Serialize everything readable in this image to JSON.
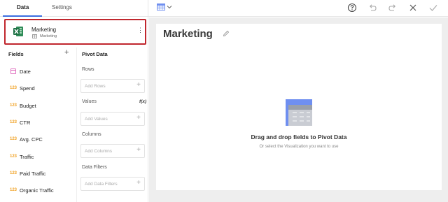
{
  "tabs": {
    "data": "Data",
    "settings": "Settings"
  },
  "datasource": {
    "name": "Marketing",
    "sub": "Marketing"
  },
  "fields": {
    "header": "Fields",
    "items": [
      {
        "label": "Date",
        "type": "date"
      },
      {
        "label": "Spend",
        "type": "123"
      },
      {
        "label": "Budget",
        "type": "123"
      },
      {
        "label": "CTR",
        "type": "123"
      },
      {
        "label": "Avg. CPC",
        "type": "123"
      },
      {
        "label": "Traffic",
        "type": "123"
      },
      {
        "label": "Paid Traffic",
        "type": "123"
      },
      {
        "label": "Organic Traffic",
        "type": "123"
      }
    ]
  },
  "pivot": {
    "header": "Pivot Data",
    "rows_label": "Rows",
    "rows_placeholder": "Add Rows",
    "values_label": "Values",
    "values_fx": "f(x)",
    "values_placeholder": "Add Values",
    "columns_label": "Columns",
    "columns_placeholder": "Add Columns",
    "filters_label": "Data Filters",
    "filters_placeholder": "Add Data Filters"
  },
  "canvas": {
    "title": "Marketing",
    "empty_title": "Drag and drop fields to Pivot Data",
    "empty_sub": "Or select the Visualization you want to use"
  },
  "colors": {
    "accent": "#3b6ee0",
    "selection_border": "#c0262d",
    "number_icon": "#f0a020",
    "excel_green": "#1e7145"
  }
}
